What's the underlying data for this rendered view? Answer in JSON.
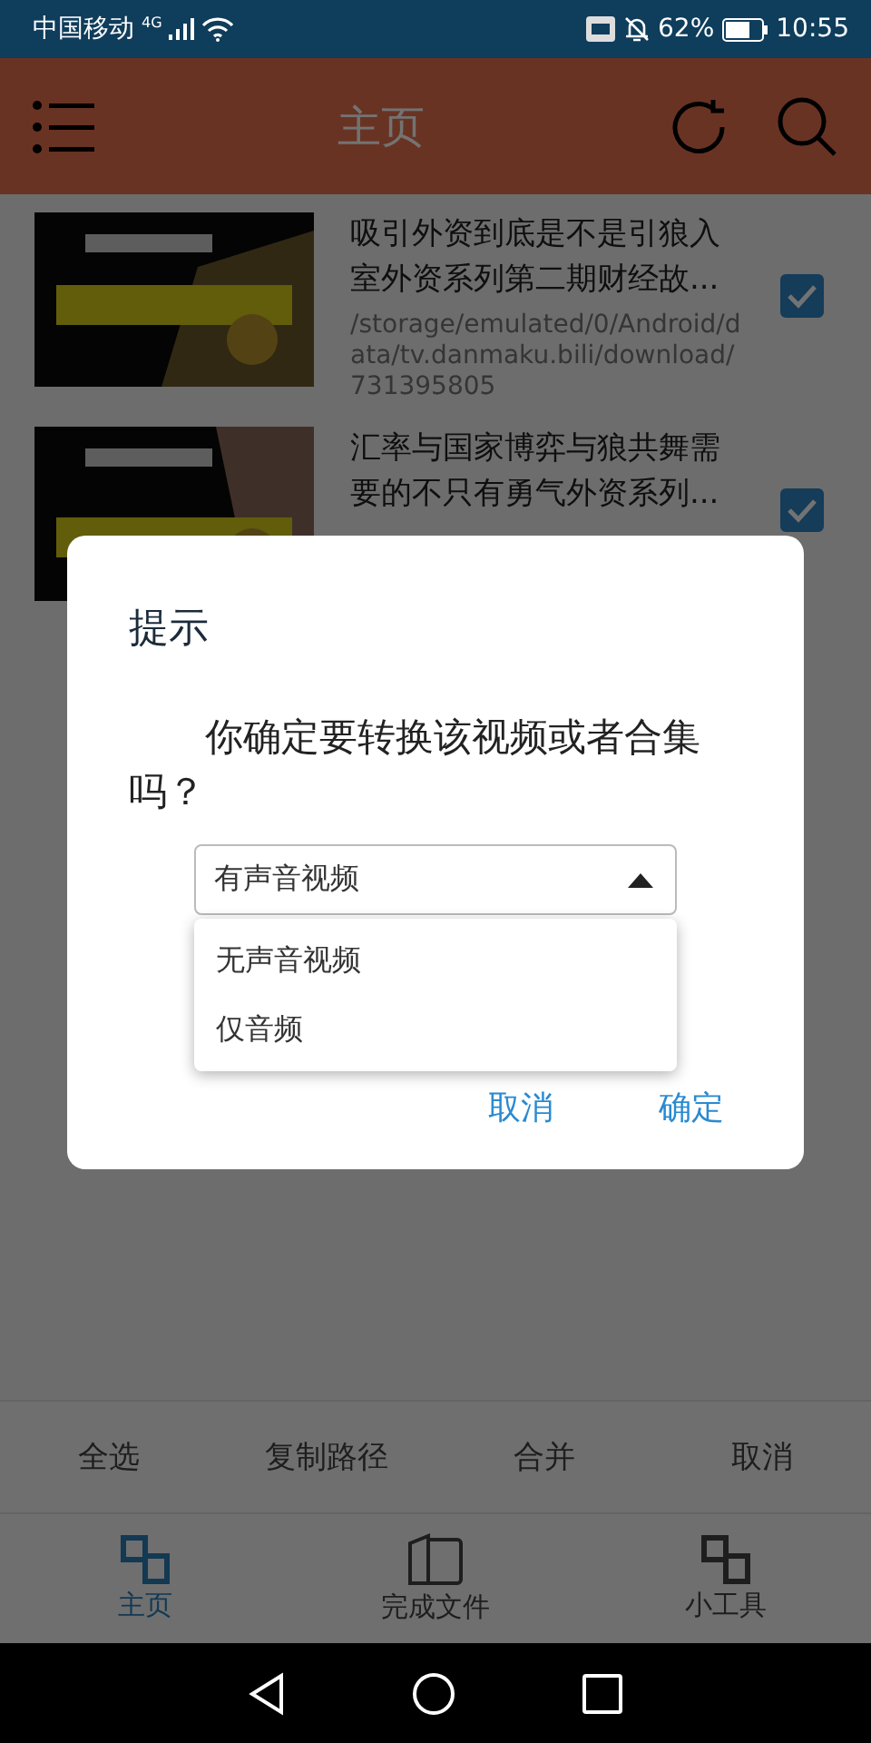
{
  "status_bar": {
    "carrier": "中国移动",
    "network": "4G",
    "battery": "62%",
    "time": "10:55"
  },
  "header": {
    "title": "主页"
  },
  "files": [
    {
      "title": "吸引外资到底是不是引狼入室外资系列第二期财经故...",
      "path": "/storage/emulated/0/Android/data/tv.danmaku.bili/download/731395805",
      "checked": true
    },
    {
      "title": "汇率与国家博弈与狼共舞需要的不只有勇气外资系列...",
      "checked": true
    }
  ],
  "dialog": {
    "title": "提示",
    "message": "你确定要转换该视频或者合集吗？",
    "select": {
      "value": "有声音视频",
      "expanded": true,
      "options": [
        "无声音视频",
        "仅音频"
      ]
    },
    "buttons": [
      "取消",
      "确定"
    ]
  },
  "actions": [
    "全选",
    "复制路径",
    "合并",
    "取消"
  ],
  "tabs": [
    {
      "label": "主页",
      "selected": true
    },
    {
      "label": "完成文件",
      "selected": false
    },
    {
      "label": "小工具",
      "selected": false
    }
  ]
}
